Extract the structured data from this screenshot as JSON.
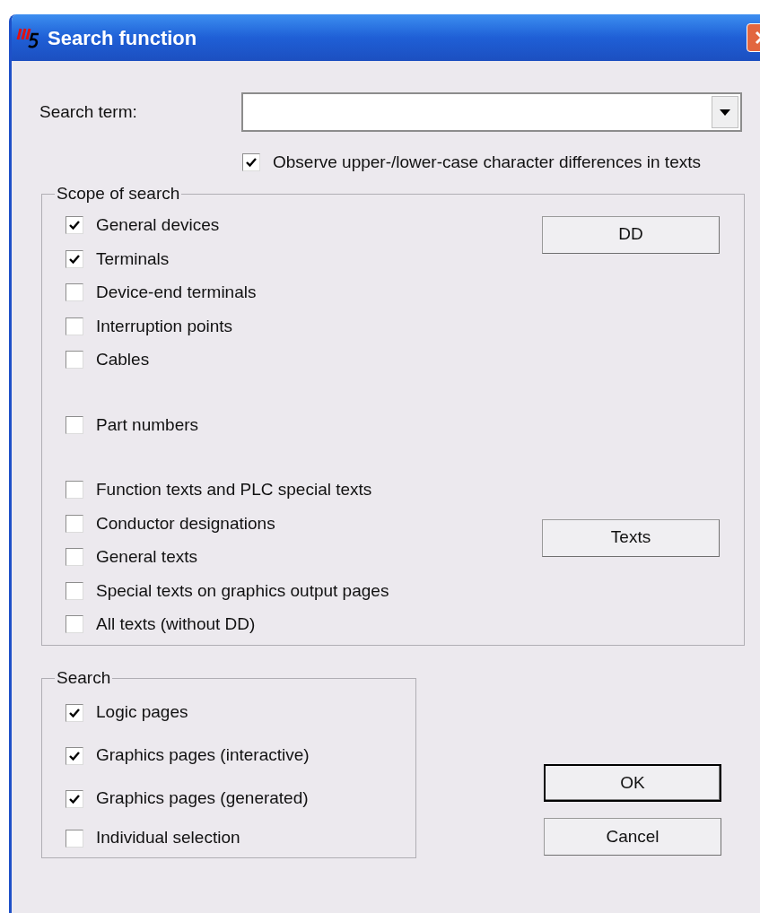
{
  "window": {
    "title": "Search function"
  },
  "search_term": {
    "label": "Search term:"
  },
  "case_option": {
    "label": "Observe upper-/lower-case character differences in texts",
    "checked": true
  },
  "scope": {
    "title": "Scope of search",
    "groups": [
      [
        {
          "label": "General devices",
          "checked": true
        },
        {
          "label": "Terminals",
          "checked": true
        },
        {
          "label": "Device-end terminals",
          "checked": false
        },
        {
          "label": "Interruption points",
          "checked": false
        },
        {
          "label": "Cables",
          "checked": false
        }
      ],
      [
        {
          "label": "Part numbers",
          "checked": false
        }
      ],
      [
        {
          "label": "Function texts and PLC special texts",
          "checked": false
        },
        {
          "label": "Conductor designations",
          "checked": false
        },
        {
          "label": "General texts",
          "checked": false
        },
        {
          "label": "Special texts on graphics output pages",
          "checked": false
        },
        {
          "label": "All texts (without DD)",
          "checked": false
        }
      ]
    ],
    "buttons": [
      "DD",
      "Texts"
    ]
  },
  "search": {
    "title": "Search",
    "items": [
      {
        "label": "Logic pages",
        "checked": true
      },
      {
        "label": "Graphics pages (interactive)",
        "checked": true
      },
      {
        "label": "Graphics pages (generated)",
        "checked": true
      },
      {
        "label": "Individual selection",
        "checked": false
      }
    ]
  },
  "buttons": [
    {
      "label": "OK",
      "default": true
    },
    {
      "label": "Cancel",
      "default": false
    }
  ]
}
